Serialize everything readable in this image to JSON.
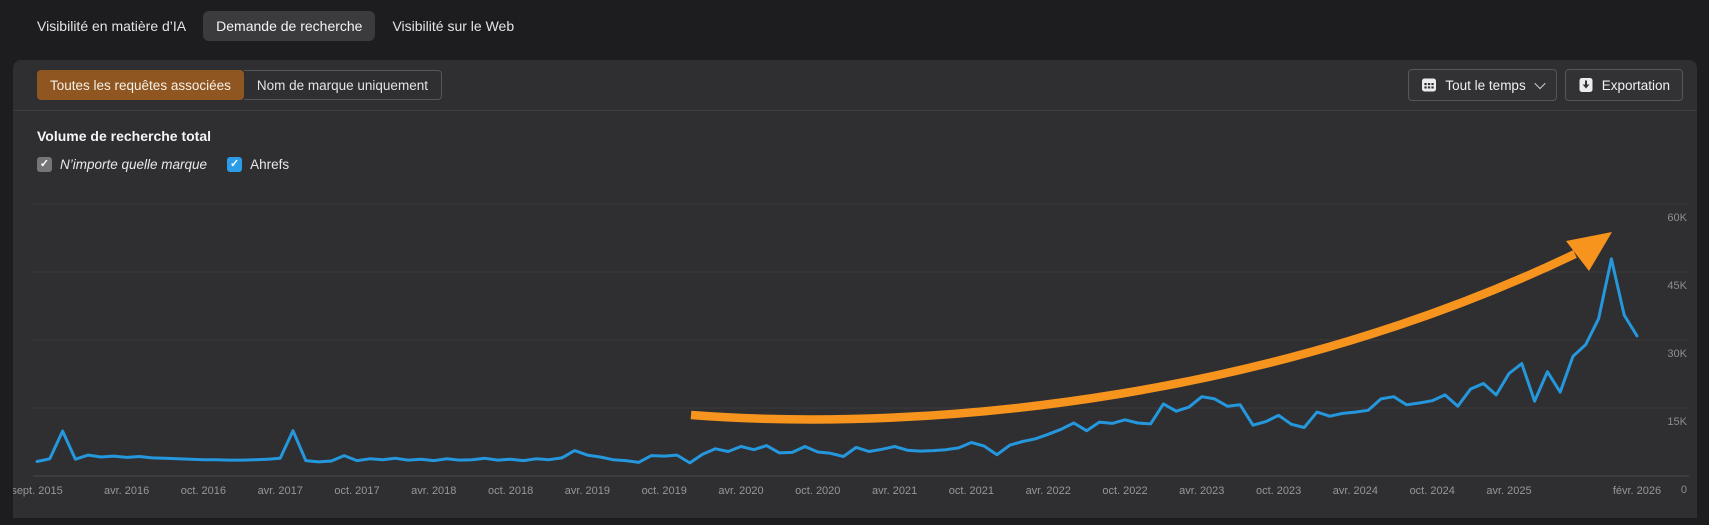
{
  "tabs": {
    "items": [
      {
        "label": "Visibilité en matière d’IA",
        "selected": false
      },
      {
        "label": "Demande de recherche",
        "selected": true
      },
      {
        "label": "Visibilité sur le Web",
        "selected": false
      }
    ]
  },
  "toolbar": {
    "query_filter": {
      "options": [
        {
          "label": "Toutes les requêtes associées",
          "selected": true
        },
        {
          "label": "Nom de marque uniquement",
          "selected": false
        }
      ],
      "selected_color": "#8f5622"
    },
    "time_range_button": {
      "label": "Tout le temps",
      "icon": "calendar-icon",
      "has_dropdown": true
    },
    "export_button": {
      "label": "Exportation",
      "icon": "download-icon"
    }
  },
  "chart_section": {
    "title": "Volume de recherche total",
    "legend": [
      {
        "label": "N’importe quelle marque",
        "checked": true,
        "color": "#747479",
        "italic": true
      },
      {
        "label": "Ahrefs",
        "checked": true,
        "color": "#2b9de8",
        "italic": false
      }
    ]
  },
  "chart_data": {
    "type": "line",
    "title": "Volume de recherche total",
    "unit": "K (thousands, monthly search volume)",
    "x_interval": "monthly",
    "x_start": "sept. 2015",
    "x_end": "févr. 2026",
    "grid": "horizontal",
    "legend_position": "top-left",
    "ylim_k": [
      0,
      65
    ],
    "y_tick_labels": [
      "60K",
      "45K",
      "30K",
      "15K",
      "0"
    ],
    "y_tick_values_k": [
      60,
      45,
      30,
      15,
      0
    ],
    "x_tick_labels": [
      {
        "label": "sept. 2015",
        "month_index": 0
      },
      {
        "label": "avr. 2016",
        "month_index": 7
      },
      {
        "label": "oct. 2016",
        "month_index": 13
      },
      {
        "label": "avr. 2017",
        "month_index": 19
      },
      {
        "label": "oct. 2017",
        "month_index": 25
      },
      {
        "label": "avr. 2018",
        "month_index": 31
      },
      {
        "label": "oct. 2018",
        "month_index": 37
      },
      {
        "label": "avr. 2019",
        "month_index": 43
      },
      {
        "label": "oct. 2019",
        "month_index": 49
      },
      {
        "label": "avr. 2020",
        "month_index": 55
      },
      {
        "label": "oct. 2020",
        "month_index": 61
      },
      {
        "label": "avr. 2021",
        "month_index": 67
      },
      {
        "label": "oct. 2021",
        "month_index": 73
      },
      {
        "label": "avr. 2022",
        "month_index": 79
      },
      {
        "label": "oct. 2022",
        "month_index": 85
      },
      {
        "label": "avr. 2023",
        "month_index": 91
      },
      {
        "label": "oct. 2023",
        "month_index": 97
      },
      {
        "label": "avr. 2024",
        "month_index": 103
      },
      {
        "label": "oct. 2024",
        "month_index": 109
      },
      {
        "label": "avr. 2025",
        "month_index": 115
      },
      {
        "label": "févr. 2026",
        "month_index": 125
      }
    ],
    "series": [
      {
        "name": "Ahrefs",
        "color": "#2597dd",
        "values_k": [
          3.2,
          3.8,
          9.9,
          3.7,
          4.6,
          4.2,
          4.4,
          4.1,
          4.3,
          4.0,
          3.9,
          3.8,
          3.7,
          3.6,
          3.6,
          3.5,
          3.5,
          3.6,
          3.7,
          3.9,
          10.0,
          3.4,
          3.1,
          3.3,
          4.5,
          3.4,
          3.8,
          3.6,
          3.9,
          3.5,
          3.7,
          3.4,
          3.8,
          3.5,
          3.6,
          3.9,
          3.5,
          3.7,
          3.4,
          3.8,
          3.6,
          4.0,
          5.6,
          4.6,
          4.2,
          3.6,
          3.4,
          3.0,
          4.5,
          4.4,
          4.6,
          2.9,
          4.8,
          6.0,
          5.4,
          6.5,
          5.8,
          6.7,
          5.1,
          5.2,
          6.5,
          5.3,
          5.0,
          4.3,
          6.3,
          5.4,
          5.9,
          6.5,
          5.7,
          5.5,
          5.6,
          5.8,
          6.2,
          7.4,
          6.6,
          4.7,
          6.8,
          7.6,
          8.2,
          9.2,
          10.3,
          11.7,
          10.0,
          11.9,
          11.6,
          12.4,
          11.7,
          11.5,
          15.9,
          14.3,
          15.2,
          17.5,
          17.0,
          15.4,
          15.7,
          11.2,
          12.0,
          13.4,
          11.4,
          10.7,
          14.1,
          13.2,
          13.8,
          14.1,
          14.5,
          17.0,
          17.5,
          15.7,
          16.1,
          16.6,
          17.9,
          15.4,
          19.2,
          20.4,
          17.9,
          22.6,
          24.8,
          16.5,
          23.0,
          18.5,
          26.4,
          29.0,
          34.7,
          47.9,
          35.5,
          30.9
        ]
      }
    ],
    "annotation": {
      "type": "arrow",
      "color": "#f7941d",
      "meaning": "accelerating upward trend drawn over the line"
    }
  }
}
